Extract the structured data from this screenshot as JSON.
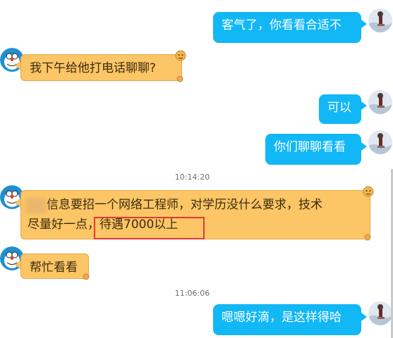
{
  "colors": {
    "outgoing_bubble": "#12b7f5",
    "incoming_bubble": "#fcc565",
    "highlight_box": "#e63a3a"
  },
  "messages": [
    {
      "sender": "me",
      "text": "客气了，你看看合适不"
    },
    {
      "sender": "other",
      "text": "我下午给他打电话聊聊?"
    },
    {
      "sender": "me",
      "text": "可以"
    },
    {
      "sender": "me",
      "text": "你们聊聊看看"
    },
    {
      "type": "timestamp",
      "text": "10:14:20"
    },
    {
      "sender": "other",
      "line1": "信息要招一个网络工程师，对学历没什么要求，技术",
      "line2_prefix": "尽量好一点，",
      "line2_highlight": "待遇7000以上"
    },
    {
      "sender": "other",
      "text": "帮忙看看"
    },
    {
      "type": "timestamp",
      "text": "11:06:06"
    },
    {
      "sender": "me",
      "text": "嗯嗯好滴，是这样得哈"
    }
  ]
}
